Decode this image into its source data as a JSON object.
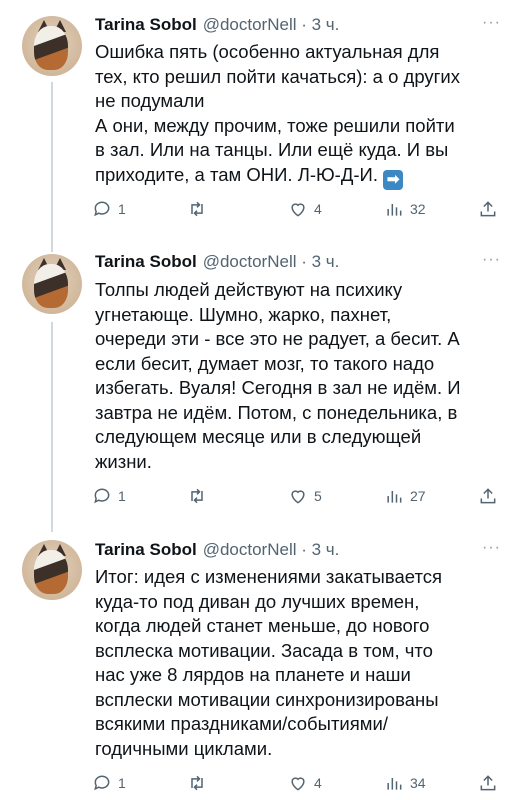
{
  "tweets": [
    {
      "author_name": "Tarina Sobol",
      "handle_time": "@doctorNell · 3 ч.",
      "more": "···",
      "text": "Ошибка пять (особенно актуальная для\nтех, кто решил пойти качаться): а о других\nне подумали\nА они, между прочим,  тоже решили пойти\nв зал. Или на танцы. Или ещё куда. И вы\nприходите,  а там ОНИ. Л-Ю-Д-И.",
      "emoji": "➡",
      "replies": "1",
      "retweets": "",
      "likes": "4",
      "views": "32"
    },
    {
      "author_name": "Tarina Sobol",
      "handle_time": "@doctorNell · 3 ч.",
      "more": "···",
      "text": "Толпы людей действуют на психику\nугнетающе. Шумно, жарко, пахнет,\nочереди эти - все это не радует,  а бесит. А\nесли бесит, думает мозг, то такого надо\nизбегать.  Вуаля! Сегодня в зал не идём. И\nзавтра не идём.  Потом, с понедельника, в\nследующем месяце или в следующей\nжизни.",
      "replies": "1",
      "retweets": "",
      "likes": "5",
      "views": "27"
    },
    {
      "author_name": "Tarina Sobol",
      "handle_time": "@doctorNell · 3 ч.",
      "more": "···",
      "text": "Итог: идея с изменениями закатывается\nкуда-то под диван до лучших времен,\nкогда людей станет меньше,  до нового\nвсплеска мотивации. Засада в том, что\nнас уже 8 лярдов на планете и наши\nвсплески мотивации синхронизированы\nвсякими праздниками/событиями/\nгодичными циклами.",
      "replies": "1",
      "retweets": "",
      "likes": "4",
      "views": "34"
    }
  ],
  "colors": {
    "text": "#0f1419",
    "secondary": "#536471",
    "thread_line": "#cfd9de"
  }
}
